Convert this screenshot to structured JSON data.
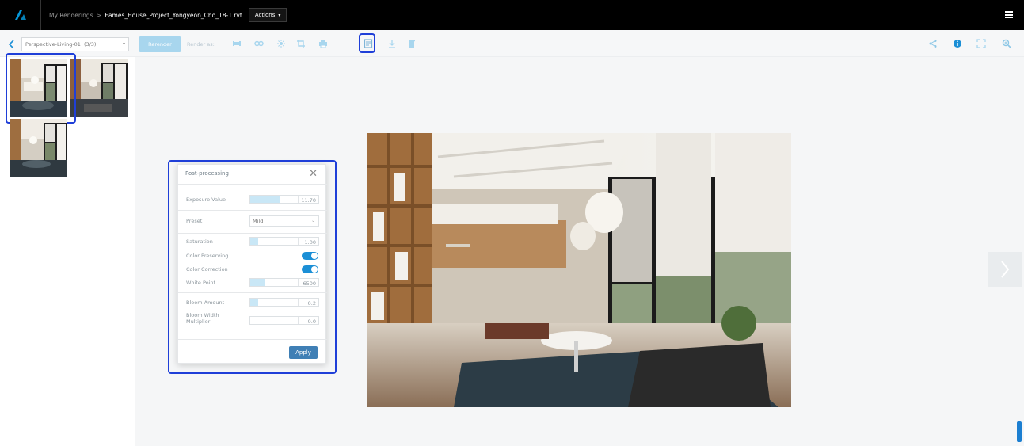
{
  "header": {
    "breadcrumb_root": "My Renderings",
    "breadcrumb_sep": ">",
    "file_name": "Eames_House_Project_Yongyeon_Cho_18-1.rvt",
    "actions_label": "Actions"
  },
  "toolbar": {
    "view_select": "Perspective-Living-01",
    "view_count": "(3/3)",
    "render_label": "Rerender",
    "render_as_label": "Render as:"
  },
  "post_processing": {
    "title": "Post-processing",
    "exposure": {
      "label": "Exposure Value",
      "value": "11.70",
      "level": 0.55
    },
    "preset": {
      "label": "Preset",
      "value": "Mild"
    },
    "saturation": {
      "label": "Saturation",
      "value": "1.00",
      "level": 0.15
    },
    "color_preserving": {
      "label": "Color Preserving",
      "on": true
    },
    "color_correction": {
      "label": "Color Correction",
      "on": true
    },
    "white_point": {
      "label": "White Point",
      "value": "6500",
      "level": 0.25
    },
    "bloom_amount": {
      "label": "Bloom Amount",
      "value": "0.2",
      "level": 0.15
    },
    "bloom_width": {
      "label": "Bloom Width Multiplier",
      "value": "0.0",
      "level": 0.0
    },
    "apply_label": "Apply"
  },
  "colors": {
    "accent": "#1b8fd6",
    "highlight": "#1f3fd8",
    "topbar": "#000000"
  }
}
